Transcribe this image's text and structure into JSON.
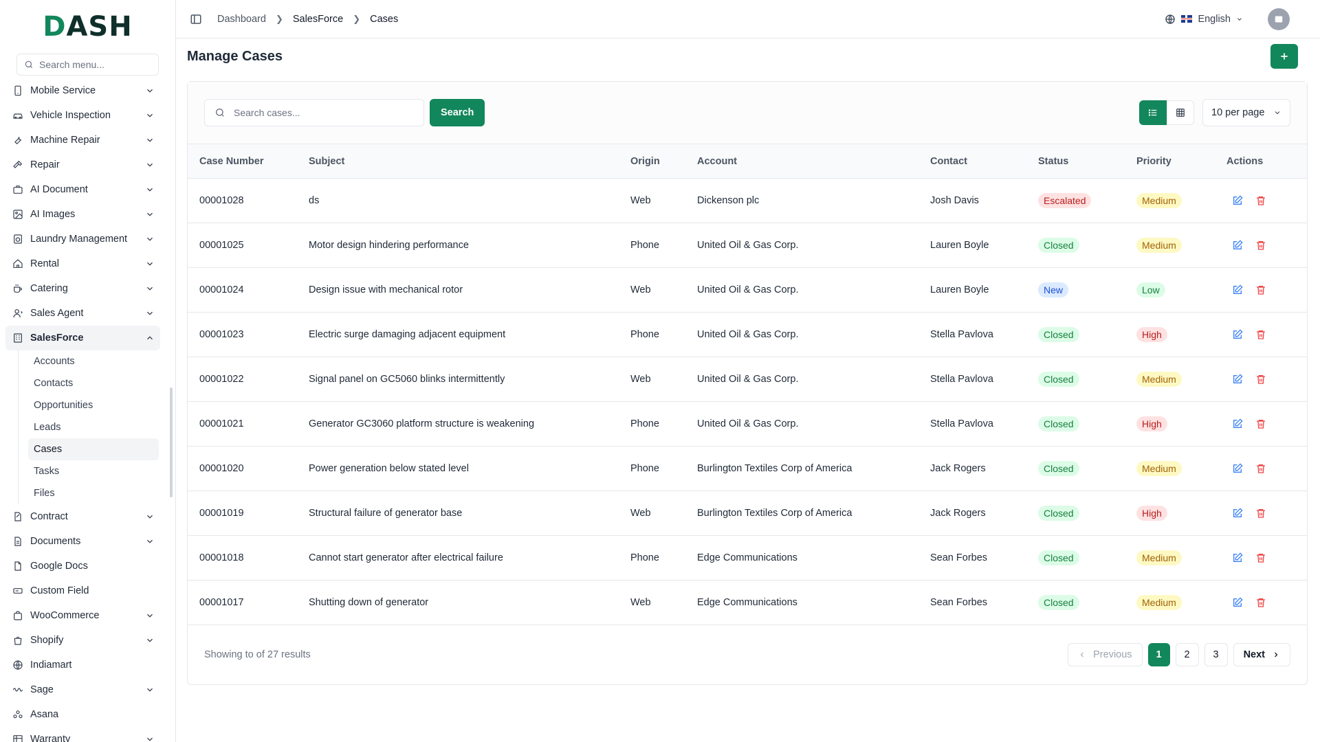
{
  "app": {
    "logo": "DASH",
    "logo_first": "D",
    "logo_rest": "ASH"
  },
  "sidebar": {
    "search_placeholder": "Search menu...",
    "items": [
      {
        "label": "Mobile Service",
        "icon": "phone-icon",
        "expandable": true
      },
      {
        "label": "Vehicle Inspection",
        "icon": "car-icon",
        "expandable": true
      },
      {
        "label": "Machine Repair",
        "icon": "wrench-icon",
        "expandable": true
      },
      {
        "label": "Repair",
        "icon": "hammer-icon",
        "expandable": true
      },
      {
        "label": "AI Document",
        "icon": "briefcase-icon",
        "expandable": true
      },
      {
        "label": "AI Images",
        "icon": "image-icon",
        "expandable": true
      },
      {
        "label": "Laundry Management",
        "icon": "washer-icon",
        "expandable": true
      },
      {
        "label": "Rental",
        "icon": "home-icon",
        "expandable": true
      },
      {
        "label": "Catering",
        "icon": "coffee-icon",
        "expandable": true
      },
      {
        "label": "Sales Agent",
        "icon": "user-icon",
        "expandable": true
      },
      {
        "label": "SalesForce",
        "icon": "building-icon",
        "expandable": true,
        "expanded": true
      }
    ],
    "salesforce_sub": [
      "Accounts",
      "Contacts",
      "Opportunities",
      "Leads",
      "Cases",
      "Tasks",
      "Files"
    ],
    "active_sub": "Cases",
    "items_after": [
      {
        "label": "Contract",
        "icon": "contract-icon",
        "expandable": true
      },
      {
        "label": "Documents",
        "icon": "document-icon",
        "expandable": true
      },
      {
        "label": "Google Docs",
        "icon": "google-docs-icon",
        "expandable": false
      },
      {
        "label": "Custom Field",
        "icon": "field-icon",
        "expandable": false
      },
      {
        "label": "WooCommerce",
        "icon": "bag-icon",
        "expandable": true
      },
      {
        "label": "Shopify",
        "icon": "shopify-icon",
        "expandable": true
      },
      {
        "label": "Indiamart",
        "icon": "globe-icon",
        "expandable": false
      },
      {
        "label": "Sage",
        "icon": "sage-icon",
        "expandable": true
      },
      {
        "label": "Asana",
        "icon": "asana-icon",
        "expandable": false
      },
      {
        "label": "Warranty",
        "icon": "warranty-icon",
        "expandable": true
      }
    ]
  },
  "header": {
    "breadcrumb": [
      "Dashboard",
      "SalesForce",
      "Cases"
    ],
    "language": "English"
  },
  "page": {
    "title": "Manage Cases",
    "search_placeholder": "Search cases...",
    "search_button": "Search",
    "per_page": "10 per page"
  },
  "table": {
    "columns": [
      "Case Number",
      "Subject",
      "Origin",
      "Account",
      "Contact",
      "Status",
      "Priority",
      "Actions"
    ],
    "rows": [
      {
        "case": "00001028",
        "subject": "ds",
        "origin": "Web",
        "account": "Dickenson plc",
        "contact": "Josh Davis",
        "status": "Escalated",
        "priority": "Medium"
      },
      {
        "case": "00001025",
        "subject": "Motor design hindering performance",
        "origin": "Phone",
        "account": "United Oil & Gas Corp.",
        "contact": "Lauren Boyle",
        "status": "Closed",
        "priority": "Medium"
      },
      {
        "case": "00001024",
        "subject": "Design issue with mechanical rotor",
        "origin": "Web",
        "account": "United Oil & Gas Corp.",
        "contact": "Lauren Boyle",
        "status": "New",
        "priority": "Low"
      },
      {
        "case": "00001023",
        "subject": "Electric surge damaging adjacent equipment",
        "origin": "Phone",
        "account": "United Oil & Gas Corp.",
        "contact": "Stella Pavlova",
        "status": "Closed",
        "priority": "High"
      },
      {
        "case": "00001022",
        "subject": "Signal panel on GC5060 blinks intermittently",
        "origin": "Web",
        "account": "United Oil & Gas Corp.",
        "contact": "Stella Pavlova",
        "status": "Closed",
        "priority": "Medium"
      },
      {
        "case": "00001021",
        "subject": "Generator GC3060 platform structure is weakening",
        "origin": "Phone",
        "account": "United Oil & Gas Corp.",
        "contact": "Stella Pavlova",
        "status": "Closed",
        "priority": "High"
      },
      {
        "case": "00001020",
        "subject": "Power generation below stated level",
        "origin": "Phone",
        "account": "Burlington Textiles Corp of America",
        "contact": "Jack Rogers",
        "status": "Closed",
        "priority": "Medium"
      },
      {
        "case": "00001019",
        "subject": "Structural failure of generator base",
        "origin": "Web",
        "account": "Burlington Textiles Corp of America",
        "contact": "Jack Rogers",
        "status": "Closed",
        "priority": "High"
      },
      {
        "case": "00001018",
        "subject": "Cannot start generator after electrical failure",
        "origin": "Phone",
        "account": "Edge Communications",
        "contact": "Sean Forbes",
        "status": "Closed",
        "priority": "Medium"
      },
      {
        "case": "00001017",
        "subject": "Shutting down of generator",
        "origin": "Web",
        "account": "Edge Communications",
        "contact": "Sean Forbes",
        "status": "Closed",
        "priority": "Medium"
      }
    ]
  },
  "pagination": {
    "showing": "Showing to of 27 results",
    "previous": "Previous",
    "next": "Next",
    "pages": [
      "1",
      "2",
      "3"
    ],
    "current": "1"
  },
  "colors": {
    "primary": "#12875b"
  }
}
